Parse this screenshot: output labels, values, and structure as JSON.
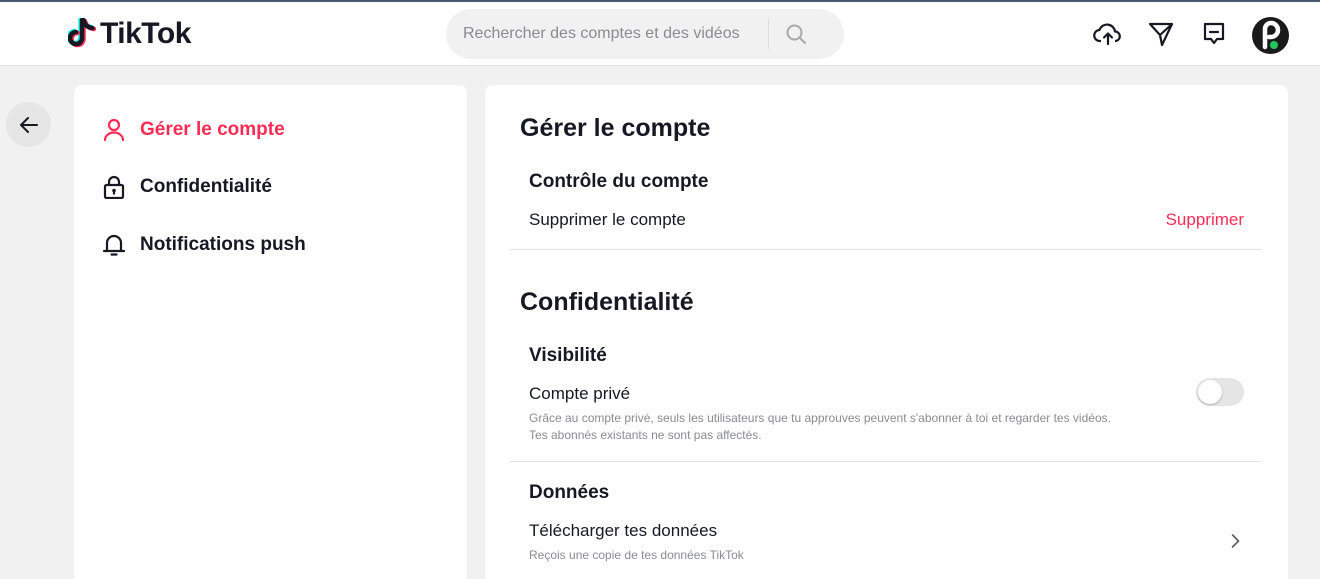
{
  "app": {
    "name": "TikTok"
  },
  "colors": {
    "accent": "#fe2c55",
    "text": "#161823",
    "muted": "#8a8b91",
    "background": "#f1f1f2"
  },
  "header": {
    "search": {
      "placeholder": "Rechercher des comptes et des vidéos",
      "icon": "search-icon"
    },
    "actions": [
      "upload-cloud-icon",
      "inbox-send-icon",
      "messages-icon"
    ],
    "avatar": "user-avatar"
  },
  "back_icon": "arrow-left-icon",
  "sidebar": {
    "items": [
      {
        "label": "Gérer le compte",
        "icon": "person-icon",
        "active": true
      },
      {
        "label": "Confidentialité",
        "icon": "lock-icon",
        "active": false
      },
      {
        "label": "Notifications push",
        "icon": "bell-icon",
        "active": false
      }
    ]
  },
  "main": {
    "manage": {
      "title": "Gérer le compte",
      "section": "Contrôle du compte",
      "delete_row": {
        "label": "Supprimer le compte",
        "action": "Supprimer"
      }
    },
    "privacy": {
      "title": "Confidentialité",
      "visibility": {
        "section": "Visibilité",
        "private_account": {
          "label": "Compte privé",
          "desc_line1": "Grâce au compte privé, seuls les utilisateurs que tu approuves peuvent s'abonner à toi et regarder tes vidéos.",
          "desc_line2": "Tes abonnés existants ne sont pas affectés.",
          "enabled": false
        }
      },
      "data": {
        "section": "Données",
        "download": {
          "label": "Télécharger tes données",
          "desc": "Reçois une copie de tes données TikTok"
        }
      }
    }
  }
}
